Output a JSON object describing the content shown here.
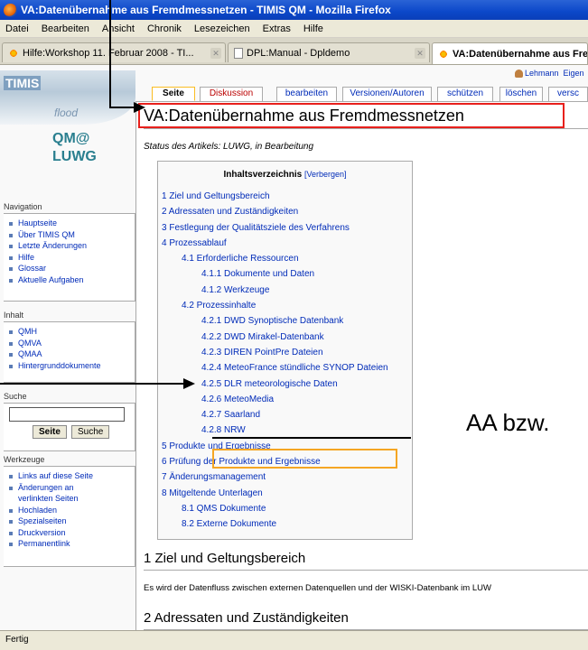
{
  "window": {
    "title": "VA:Datenübernahme aus Fremdmessnetzen - TIMIS QM - Mozilla Firefox"
  },
  "menubar": [
    "Datei",
    "Bearbeiten",
    "Ansicht",
    "Chronik",
    "Lesezeichen",
    "Extras",
    "Hilfe"
  ],
  "browser_tabs": [
    {
      "label": "Hilfe:Workshop 11. Februar 2008 - TI...",
      "icon": "wiki-icon"
    },
    {
      "label": "DPL:Manual - Dpldemo",
      "icon": "document-icon"
    },
    {
      "label": "VA:Datenübernahme aus Fre",
      "icon": "wiki-icon",
      "active": true
    }
  ],
  "sidebar": {
    "logo": {
      "brand": "TIMIS",
      "sub": "flood",
      "qm": "QM@",
      "org": "LUWG"
    },
    "navigation": {
      "title": "Navigation",
      "items": [
        "Hauptseite",
        "Über TIMIS QM",
        "Letzte Änderungen",
        "Hilfe",
        "Glossar",
        "Aktuelle Aufgaben"
      ]
    },
    "inhalt": {
      "title": "Inhalt",
      "items": [
        "QMH",
        "QMVA",
        "QMAA",
        "Hintergrunddokumente"
      ]
    },
    "search": {
      "title": "Suche",
      "go_label": "Seite",
      "search_label": "Suche",
      "value": ""
    },
    "toolbox": {
      "title": "Werkzeuge",
      "items": [
        "Links auf diese Seite",
        "Änderungen an verlinkten Seiten",
        "Hochladen",
        "Spezialseiten",
        "Druckversion",
        "Permanentlink"
      ]
    }
  },
  "page_tabs": [
    "Seite",
    "Diskussion",
    "bearbeiten",
    "Versionen/Autoren",
    "schützen",
    "löschen",
    "versc"
  ],
  "user_links": {
    "user": "Lehmann",
    "own": "Eigen"
  },
  "page": {
    "title": "VA:Datenübernahme aus Fremdmessnetzen",
    "status": "Status des Artikels: LUWG, in Bearbeitung",
    "toc": {
      "title": "Inhaltsverzeichnis",
      "hide_label": "[Verbergen]",
      "items": [
        "1 Ziel und Geltungsbereich",
        "2 Adressaten und Zuständigkeiten",
        "3 Festlegung der Qualitätsziele des Verfahrens",
        "4 Prozessablauf",
        "4.1 Erforderliche Ressourcen",
        "4.1.1 Dokumente und Daten",
        "4.1.2 Werkzeuge",
        "4.2 Prozessinhalte",
        "4.2.1 DWD Synoptische Datenbank",
        "4.2.2 DWD Mirakel-Datenbank",
        "4.2.3 DIREN PointPre Dateien",
        "4.2.4 MeteoFrance stündliche SYNOP Dateien",
        "4.2.5 DLR meteorologische Daten",
        "4.2.6 MeteoMedia",
        "4.2.7 Saarland",
        "4.2.8 NRW",
        "5 Produkte und Ergebnisse",
        "6 Prüfung der Produkte und Ergebnisse",
        "7 Änderungsmanagement",
        "8 Mitgeltende Unterlagen",
        "8.1 QMS Dokumente",
        "8.2 Externe Dokumente"
      ],
      "levels": [
        1,
        1,
        1,
        1,
        2,
        3,
        3,
        2,
        3,
        3,
        3,
        3,
        3,
        3,
        3,
        3,
        1,
        1,
        1,
        1,
        2,
        2
      ]
    },
    "section1": "1 Ziel und Geltungsbereich",
    "section1_text": "Es wird der Datenfluss zwischen externen Datenquellen und der WISKI-Datenbank im LUW",
    "section2": "2 Adressaten und Zuständigkeiten"
  },
  "overlay_text": "AA bzw.",
  "statusbar": "Fertig",
  "colors": {
    "titlebar": "#0b47c9",
    "link": "#002bb8",
    "title_box": "#e8201c",
    "toc_highlight": "#f5a623",
    "selected_tab": "#fabd23"
  }
}
